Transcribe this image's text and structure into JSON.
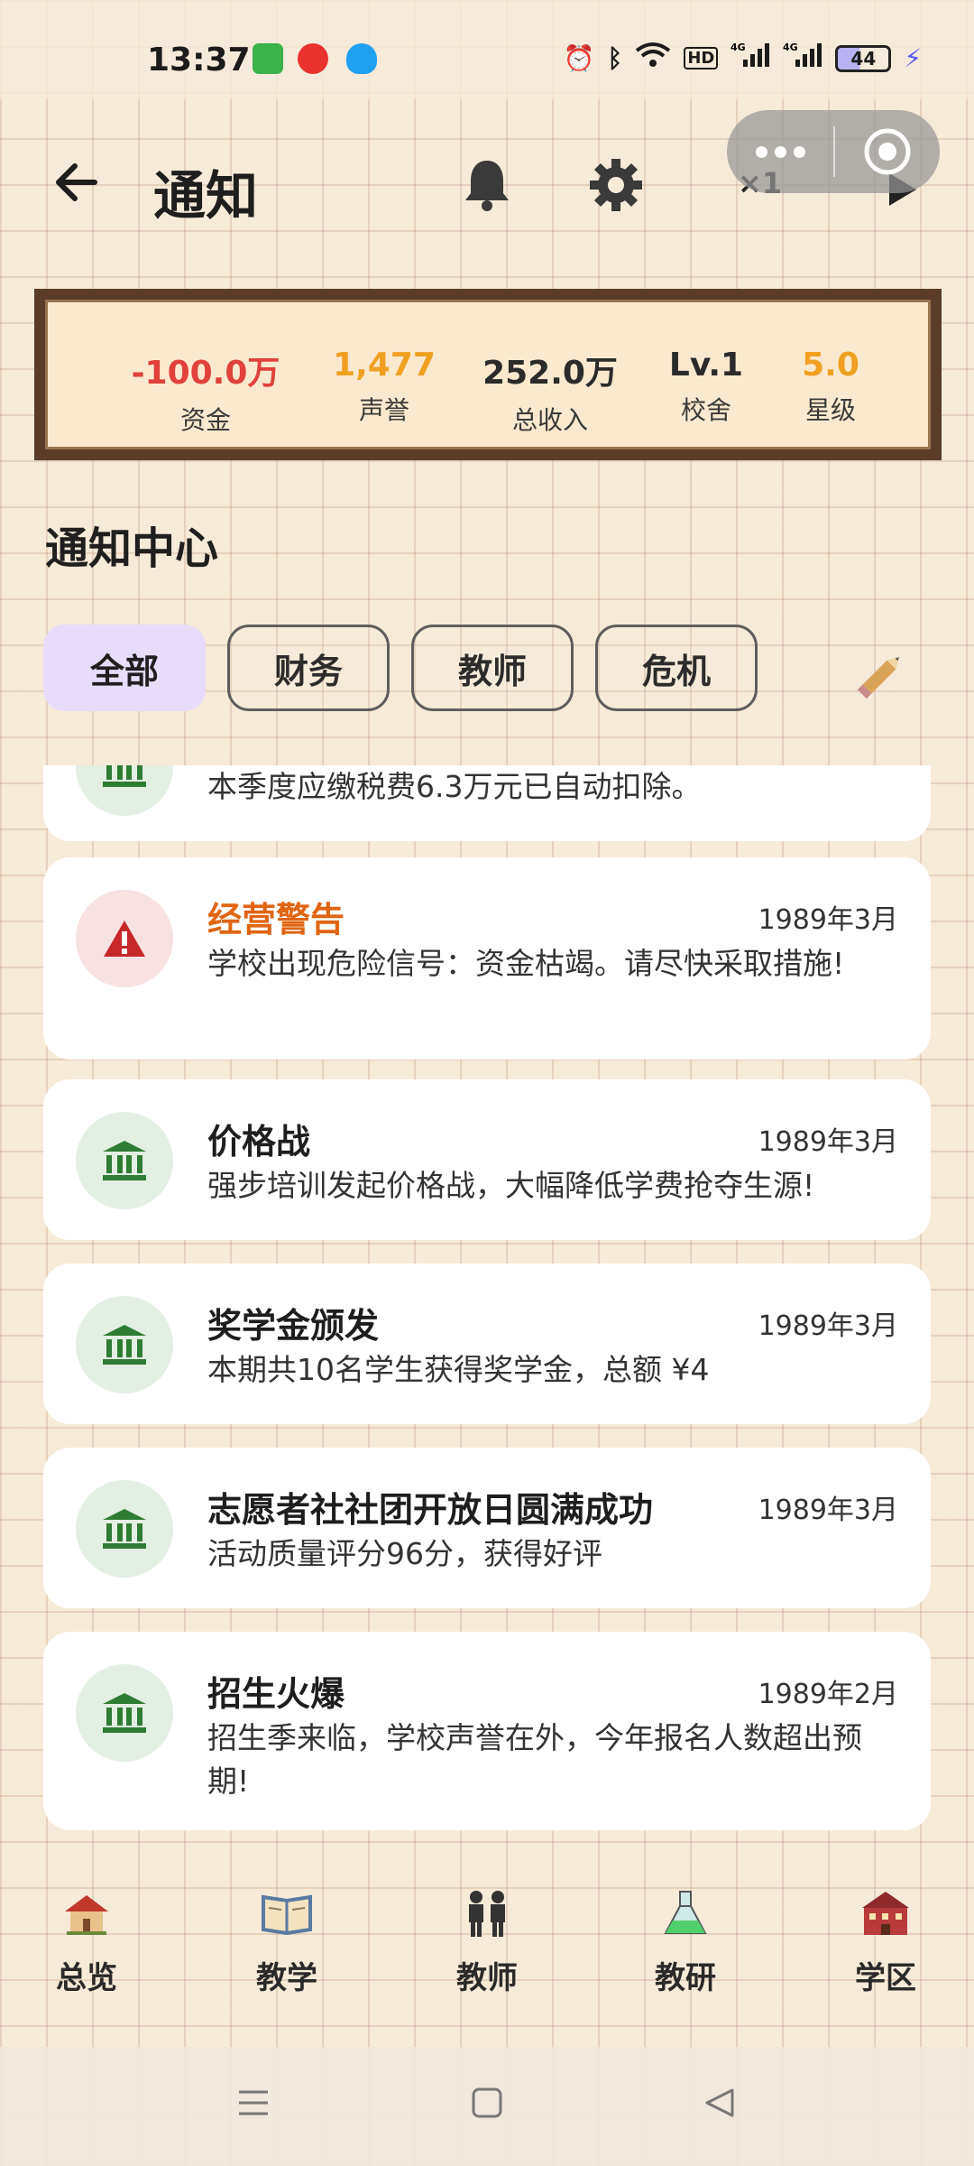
{
  "status_bar": {
    "time": "13:37",
    "battery": "44",
    "network": "4G"
  },
  "header": {
    "title": "通知",
    "speed": "×1"
  },
  "stats": [
    {
      "value": "-100.0万",
      "label": "资金",
      "color": "#e0413a"
    },
    {
      "value": "1,477",
      "label": "声誉",
      "color": "#f0a020"
    },
    {
      "value": "252.0万",
      "label": "总收入",
      "color": "#2b2b2b"
    },
    {
      "value": "Lv.1",
      "label": "校舍",
      "color": "#2b2b2b"
    },
    {
      "value": "5.0",
      "label": "星级",
      "color": "#f0a020"
    }
  ],
  "section_title": "通知中心",
  "tabs": [
    {
      "label": "全部",
      "active": true
    },
    {
      "label": "财务",
      "active": false
    },
    {
      "label": "教师",
      "active": false
    },
    {
      "label": "危机",
      "active": false
    }
  ],
  "notifications": [
    {
      "title": "",
      "date": "",
      "body": "本季度应缴税费6.3万元已自动扣除。",
      "icon": "bank-icon",
      "type": "finance"
    },
    {
      "title": "经营警告",
      "date": "1989年3月",
      "body": "学校出现危险信号：资金枯竭。请尽快采取措施!",
      "icon": "warning-icon",
      "type": "crisis"
    },
    {
      "title": "价格战",
      "date": "1989年3月",
      "body": "强步培训发起价格战，大幅降低学费抢夺生源!",
      "icon": "bank-icon",
      "type": "finance"
    },
    {
      "title": "奖学金颁发",
      "date": "1989年3月",
      "body": "本期共10名学生获得奖学金，总额 ¥4",
      "icon": "bank-icon",
      "type": "finance"
    },
    {
      "title": "志愿者社社团开放日圆满成功",
      "date": "1989年3月",
      "body": "活动质量评分96分，获得好评",
      "icon": "bank-icon",
      "type": "finance"
    },
    {
      "title": "招生火爆",
      "date": "1989年2月",
      "body": "招生季来临，学校声誉在外，今年报名人数超出预期!",
      "icon": "bank-icon",
      "type": "finance"
    }
  ],
  "bottom_nav": [
    {
      "label": "总览",
      "icon": "school-house-icon"
    },
    {
      "label": "教学",
      "icon": "open-book-icon"
    },
    {
      "label": "教师",
      "icon": "teachers-icon"
    },
    {
      "label": "教研",
      "icon": "flask-icon"
    },
    {
      "label": "学区",
      "icon": "campus-building-icon"
    }
  ]
}
